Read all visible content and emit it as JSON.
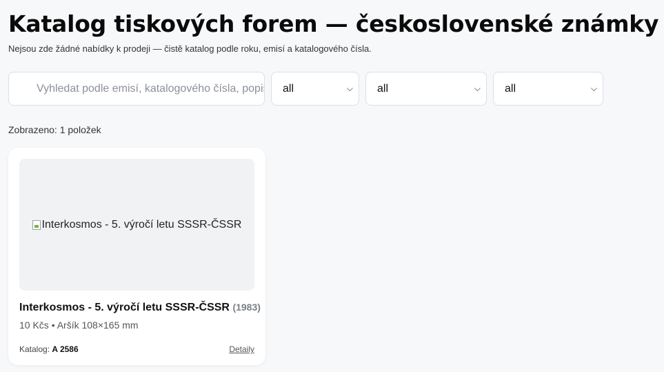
{
  "header": {
    "title": "Katalog tiskových forem — československé známky",
    "subtitle": "Nejsou zde žádné nabídky k prodeji — čistě katalog podle roku, emisí a katalogového čísla."
  },
  "filters": {
    "search_placeholder": "Vyhledat podle emisí, katalogového čísla, popisu",
    "year_value": "all",
    "emission_value": "all",
    "type_value": "all"
  },
  "results": {
    "count_text": "Zobrazeno: 1 položek"
  },
  "items": [
    {
      "image_alt": "Interkosmos - 5. výročí letu SSSR-ČSSR",
      "title": "Interkosmos - 5. výročí letu SSSR-ČSSR",
      "year": "(1983)",
      "meta": "10 Kčs • Aršík 108×165 mm",
      "catalog_label": "Katalog:",
      "catalog_number": "A 2586",
      "details_label": "Detaily"
    }
  ],
  "icons": {
    "select_chevron": "chevron-down-icon",
    "broken_image": "broken-image-icon"
  }
}
